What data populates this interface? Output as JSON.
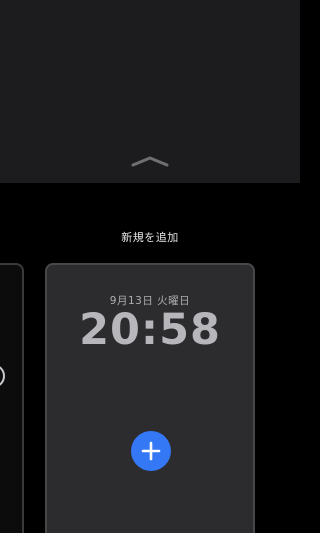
{
  "header": {
    "add_new_label": "新規を追加"
  },
  "preview_card": {
    "date": "9月13日 火曜日",
    "time": "20:58"
  },
  "icons": {
    "grabber": "chevron-up-icon",
    "add": "plus-icon"
  },
  "colors": {
    "background": "#000000",
    "top_panel": "#1c1c1e",
    "card": "#2c2c2e",
    "accent": "#3478f6"
  }
}
